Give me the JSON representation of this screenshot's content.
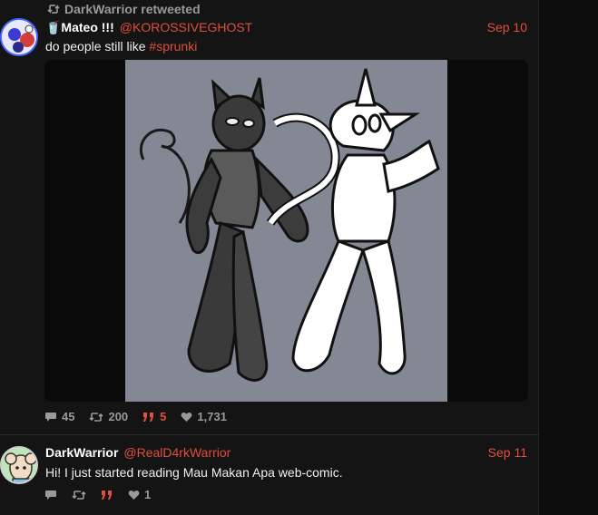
{
  "retweet": {
    "label": "DarkWarrior retweeted"
  },
  "tweets": [
    {
      "name": "🥤Mateo !!!",
      "handle": "@KOROSSIVEGHOST",
      "date": "Sep 10",
      "text": "do people still like ",
      "hashtag": "#sprunki",
      "stats": {
        "replies": "45",
        "retweets": "200",
        "quotes": "5",
        "likes": "1,731"
      }
    },
    {
      "name": "DarkWarrior",
      "handle": "@RealD4rkWarrior",
      "date": "Sep 11",
      "text": "Hi! I just started reading Mau Makan Apa web-comic.",
      "stats": {
        "likes": "1"
      }
    }
  ],
  "colors": {
    "accent": "#e0503c",
    "muted": "#9a9a9a",
    "background": "#141414"
  },
  "icons": {
    "retweet": "retweet-icon",
    "reply": "reply-icon",
    "quote": "quote-icon",
    "like": "heart-icon"
  }
}
